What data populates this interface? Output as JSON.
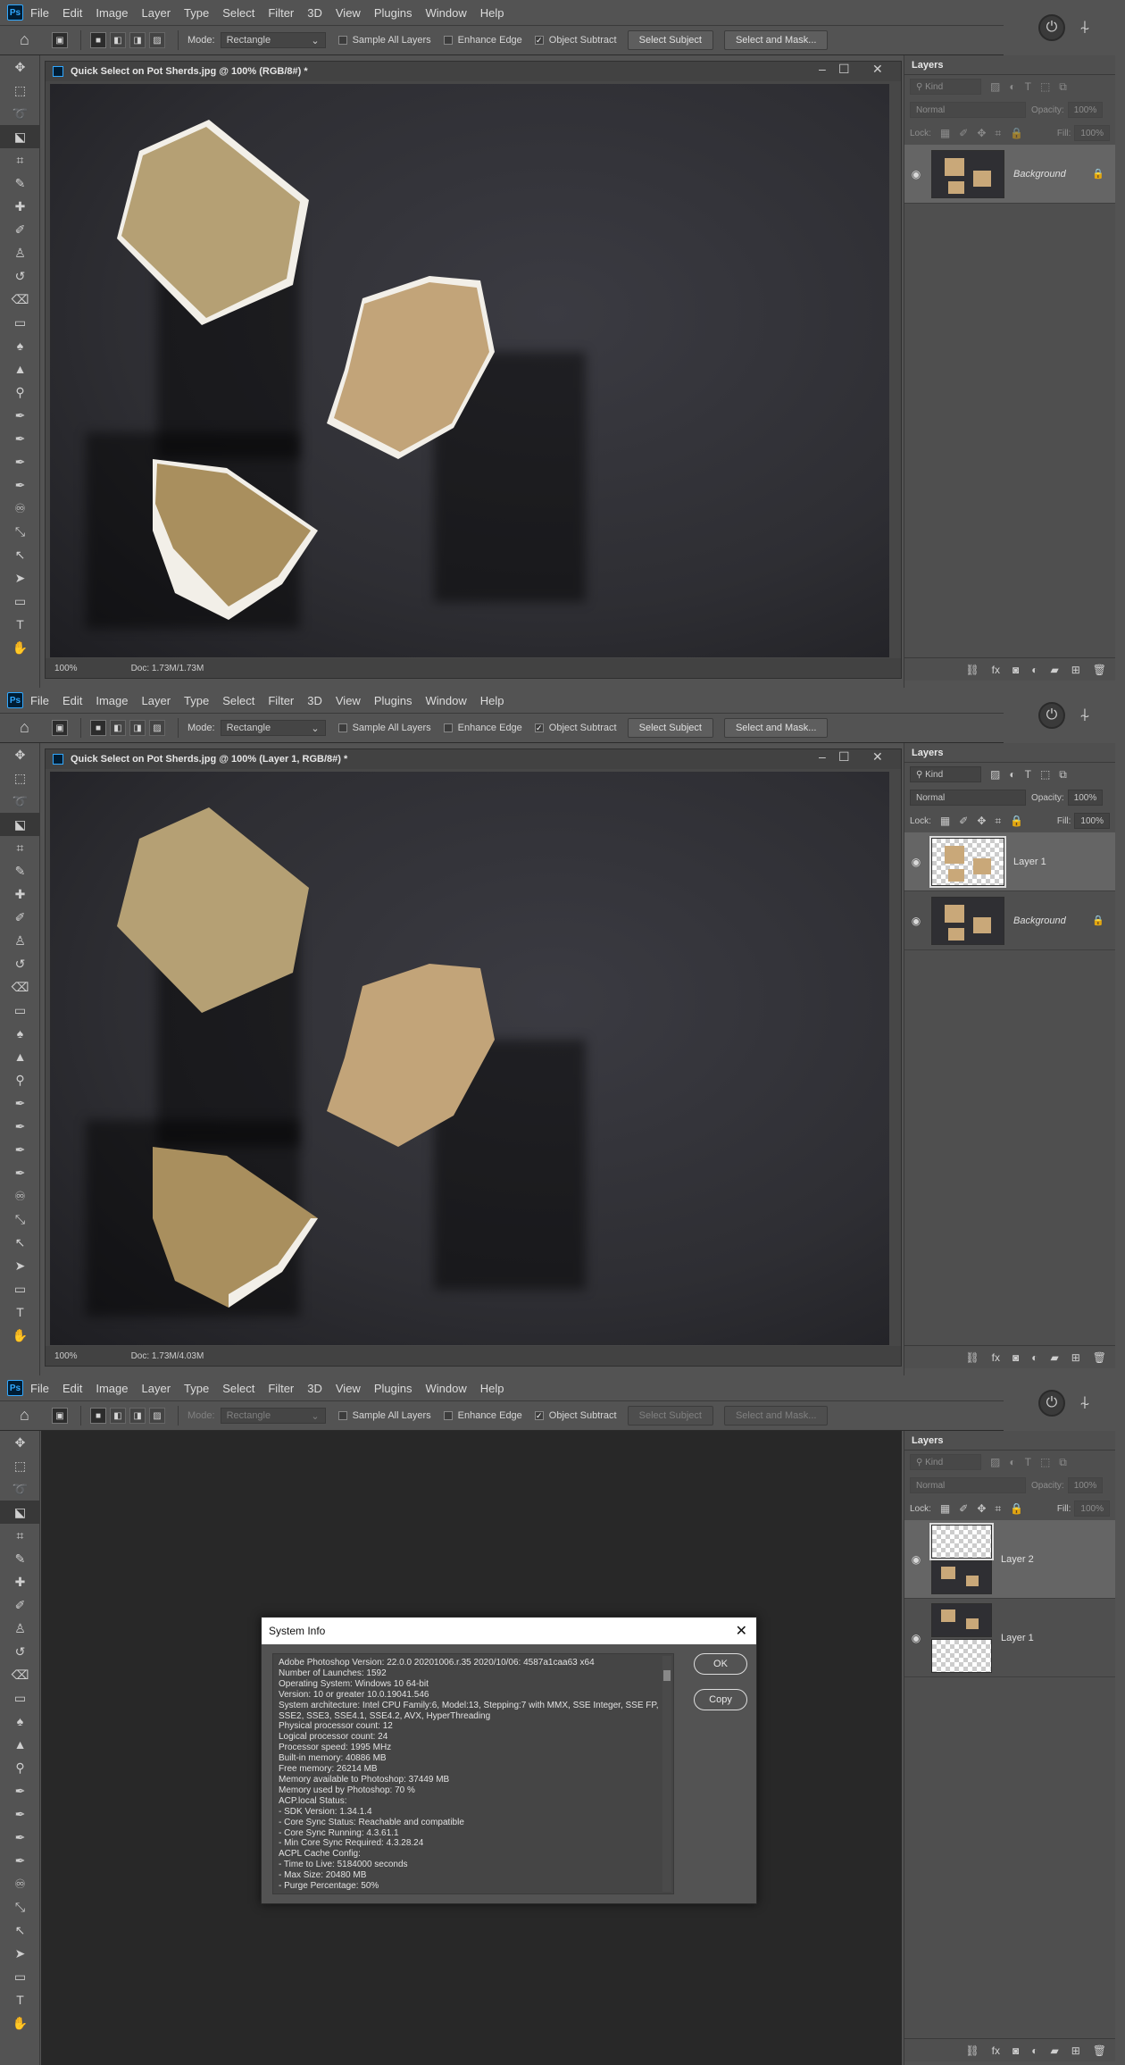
{
  "menu": {
    "logo": "Ps",
    "items": [
      "File",
      "Edit",
      "Image",
      "Layer",
      "Type",
      "Select",
      "Filter",
      "3D",
      "View",
      "Plugins",
      "Window",
      "Help"
    ]
  },
  "options": {
    "mode_label": "Mode:",
    "mode_value": "Rectangle",
    "sample_all": "Sample All Layers",
    "enhance_edge": "Enhance Edge",
    "object_subtract": "Object Subtract",
    "select_subject": "Select Subject",
    "select_mask": "Select and Mask..."
  },
  "layers_panel": {
    "tab": "Layers",
    "kind": "Kind",
    "blend": "Normal",
    "opacity_label": "Opacity:",
    "opacity_value": "100%",
    "lock_label": "Lock:",
    "fill_label": "Fill:",
    "fill_value": "100%"
  },
  "panel1": {
    "doc_title": "Quick Select on Pot Sherds.jpg @ 100% (RGB/8#) *",
    "zoom": "100%",
    "doc_size": "Doc: 1.73M/1.73M",
    "layers": [
      {
        "name": "Background"
      }
    ]
  },
  "panel2": {
    "doc_title": "Quick Select on Pot Sherds.jpg @ 100% (Layer 1, RGB/8#) *",
    "zoom": "100%",
    "doc_size": "Doc: 1.73M/4.03M",
    "layers": [
      {
        "name": "Layer 1"
      },
      {
        "name": "Background"
      }
    ]
  },
  "panel3": {
    "layers": [
      {
        "name": "Layer 2"
      },
      {
        "name": "Layer 1"
      }
    ]
  },
  "dialog": {
    "title": "System Info",
    "ok": "OK",
    "copy": "Copy",
    "lines": [
      "Adobe Photoshop Version: 22.0.0 20201006.r.35 2020/10/06: 4587a1caa63  x64",
      "Number of Launches: 1592",
      "Operating System: Windows 10 64-bit",
      "Version: 10 or greater 10.0.19041.546",
      "System architecture: Intel CPU Family:6, Model:13, Stepping:7 with MMX, SSE Integer, SSE FP,",
      "SSE2, SSE3, SSE4.1, SSE4.2, AVX, HyperThreading",
      "Physical processor count: 12",
      "Logical processor count: 24",
      "Processor speed: 1995 MHz",
      "Built-in memory: 40886 MB",
      "Free memory: 26214 MB",
      "Memory available to Photoshop: 37449 MB",
      "Memory used by Photoshop: 70 %",
      "ACP.local Status:",
      "  - SDK Version: 1.34.1.4",
      "  - Core Sync Status: Reachable and compatible",
      "  - Core Sync Running: 4.3.61.1",
      "  - Min Core Sync Required: 4.3.28.24",
      "ACPL Cache Config:",
      "  - Time to Live: 5184000 seconds",
      "  - Max Size: 20480 MB",
      "  - Purge Percentage: 50%"
    ]
  }
}
